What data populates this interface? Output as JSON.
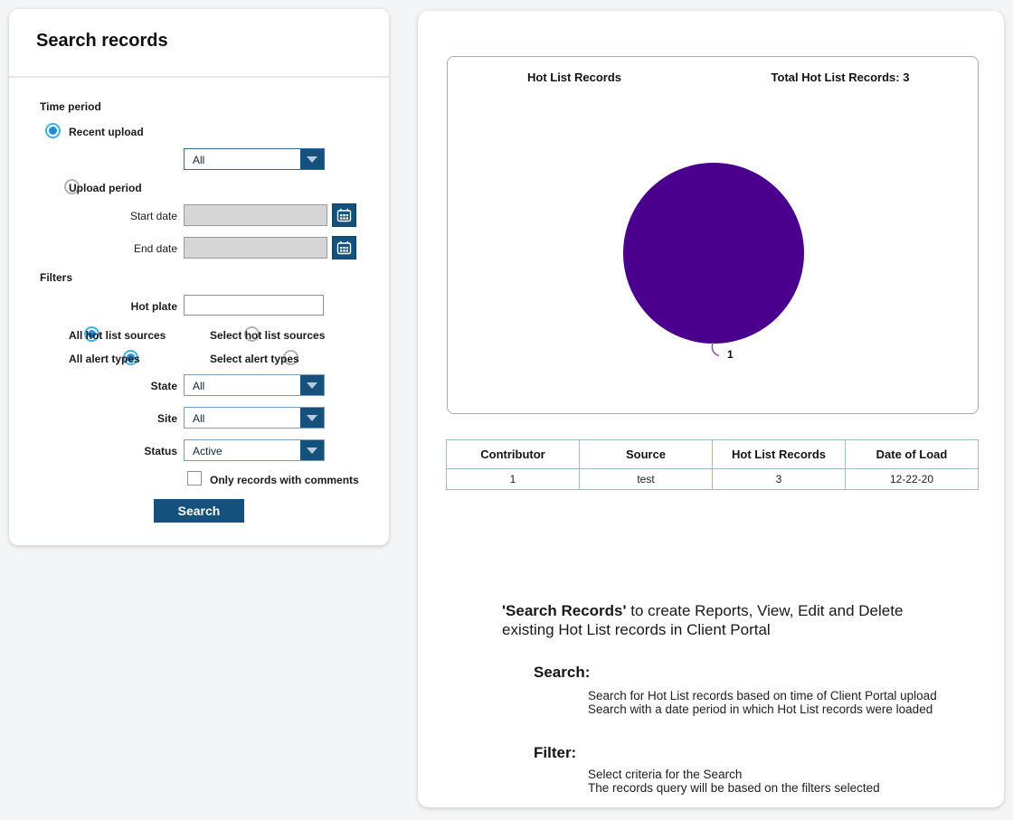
{
  "colors": {
    "accent_blue": "#14517c",
    "radio_selected": "#1f8fd6",
    "pie_purple": "#4a008c",
    "table_border": "#9fb9cc",
    "page_background": "#f4f5f7"
  },
  "search_panel": {
    "title": "Search records",
    "time_period": {
      "label": "Time period",
      "recent_upload": {
        "label": "Recent upload",
        "selected": true
      },
      "recent_upload_range": {
        "value": "All"
      },
      "upload_period": {
        "label": "Upload period",
        "selected": false
      },
      "start_date": {
        "label": "Start date",
        "value": ""
      },
      "end_date": {
        "label": "End date",
        "value": ""
      }
    },
    "filters": {
      "label": "Filters",
      "hot_plate": {
        "label": "Hot plate",
        "value": ""
      },
      "all_hot_list_sources": {
        "label": "All hot list sources",
        "selected": true
      },
      "select_hot_list_sources": {
        "label": "Select hot list sources",
        "selected": false
      },
      "all_alert_types": {
        "label": "All alert types",
        "selected": true
      },
      "select_alert_types": {
        "label": "Select alert types",
        "selected": false
      },
      "state": {
        "label": "State",
        "value": "All"
      },
      "site": {
        "label": "Site",
        "value": "All"
      },
      "status": {
        "label": "Status",
        "value": "Active"
      },
      "comments_checkbox": {
        "label": "Only records with comments",
        "checked": false
      }
    },
    "search_button": "Search"
  },
  "chart_data": {
    "type": "pie",
    "title": "Hot List Records",
    "annotation": "Total Hot List Records: 3",
    "labels": [
      "1"
    ],
    "values": [
      3
    ],
    "colors": [
      "#4a008c"
    ],
    "legend_position": "none",
    "slice_label_text": "1"
  },
  "results_panel": {
    "chart": {
      "title": "Hot List Records",
      "total_label": "Total Hot List Records: 3",
      "slice_label": "1"
    },
    "table": {
      "headers": [
        "Contributor",
        "Source",
        "Hot List Records",
        "Date of Load"
      ],
      "rows": [
        [
          "1",
          "test",
          "3",
          "12-22-20"
        ]
      ]
    },
    "help": {
      "intro_bold": "'Search Records'",
      "intro_rest": " to create Reports, View, Edit and Delete existing Hot List records in Client Portal",
      "search_heading": "Search:",
      "search_lines": [
        "Search for Hot List records based on time of Client Portal upload",
        "Search with a date period in which Hot List records were loaded"
      ],
      "filter_heading": "Filter:",
      "filter_lines": [
        "Select criteria for the Search",
        "The records query will be based on the filters selected"
      ]
    }
  }
}
